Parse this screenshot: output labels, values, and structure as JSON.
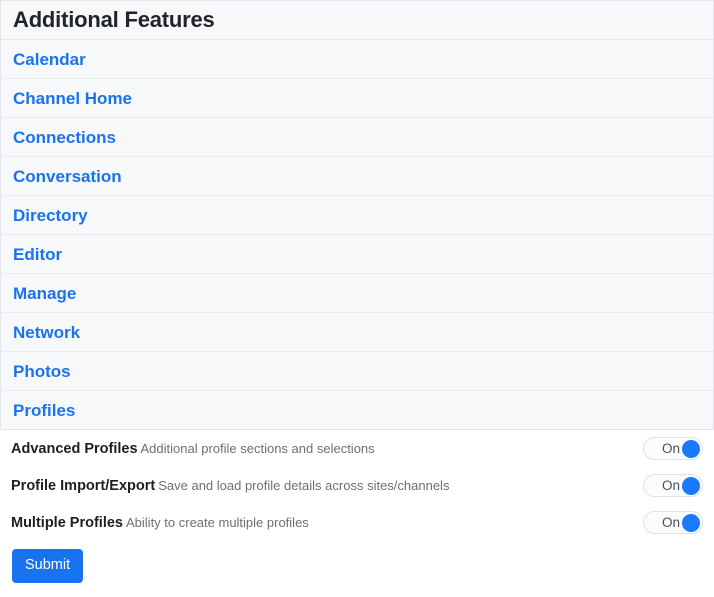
{
  "panel": {
    "title": "Additional Features",
    "links": [
      {
        "label": "Calendar"
      },
      {
        "label": "Channel Home"
      },
      {
        "label": "Connections"
      },
      {
        "label": "Conversation"
      },
      {
        "label": "Directory"
      },
      {
        "label": "Editor"
      },
      {
        "label": "Manage"
      },
      {
        "label": "Network"
      },
      {
        "label": "Photos"
      },
      {
        "label": "Profiles"
      }
    ]
  },
  "features": [
    {
      "name": "Advanced Profiles",
      "description": "Additional profile sections and selections",
      "toggle_label": "On",
      "toggle_state": "on"
    },
    {
      "name": "Profile Import/Export",
      "description": "Save and load profile details across sites/channels",
      "toggle_label": "On",
      "toggle_state": "on"
    },
    {
      "name": "Multiple Profiles",
      "description": "Ability to create multiple profiles",
      "toggle_label": "On",
      "toggle_state": "on"
    }
  ],
  "actions": {
    "submit_label": "Submit"
  },
  "colors": {
    "link_blue": "#1a73ee",
    "toggle_knob_blue": "#1a7aff",
    "submit_blue": "#1a73ee",
    "row_background": "#f7f8fa",
    "border": "#e3e6ea",
    "text_primary": "#1d1f23",
    "text_muted": "#6a7076"
  }
}
